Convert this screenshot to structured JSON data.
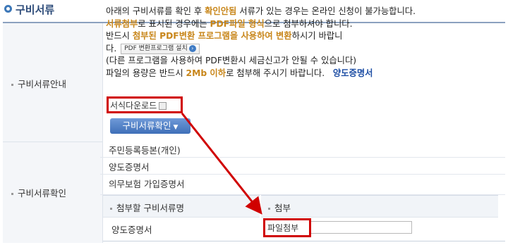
{
  "section": {
    "title": "구비서류"
  },
  "guide": {
    "label": "구비서류안내",
    "line1": {
      "a": "아래의 구비서류를 확인 후 ",
      "b": "확인안됨",
      "c": " 서류가 있는 경우는 온라인 신청이 불가능합니다."
    },
    "line2": {
      "a": "서류첨부",
      "b": "로 표시된 경우에는 ",
      "c": "PDF파일 형식",
      "d": "으로 첨부하셔야 합니다."
    },
    "line3": {
      "a": "반드시 ",
      "b": "첨부된 PDF변환 프로그램을 사용하여 변환",
      "c": "하시기 바랍니"
    },
    "line4": {
      "a": "다."
    },
    "pdf_button": "PDF 변환프로그램 설치",
    "line5": "(다른 프로그램을 사용하여 PDF변환시 세금신고가 안될 수 있습니다)",
    "line6": {
      "a": "파일의 용량은 반드시 ",
      "b": "2Mb 이하",
      "c": "로 첨부해 주시기 바랍니다.",
      "d": "양도증명서"
    },
    "download_button": "서식다운로드",
    "check_button": "구비서류확인"
  },
  "confirm": {
    "label": "구비서류확인",
    "documents": [
      "주민등록등본(개인)",
      "양도증명서",
      "의무보험 가입증명서"
    ],
    "table": {
      "col_name": "첨부할 구비서류명",
      "col_attach": "첨부",
      "rows": [
        {
          "name": "양도증명서",
          "attach_button": "파일첨부",
          "file_value": ""
        }
      ]
    }
  },
  "colors": {
    "accent_orange": "#c8861a",
    "link_blue": "#1f4fa5",
    "highlight_red": "#d00000",
    "button_blue": "#4a78bf"
  }
}
